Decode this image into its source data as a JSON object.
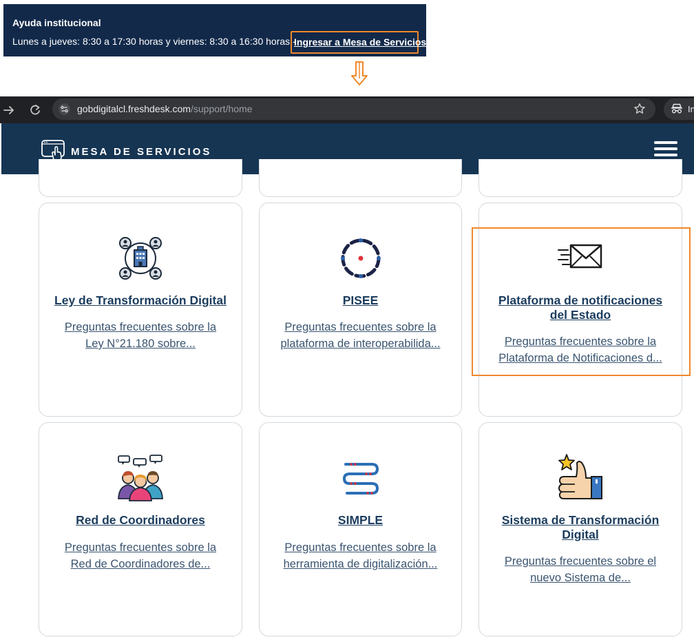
{
  "help_banner": {
    "title": "Ayuda institucional",
    "hours": "Lunes a jueves: 8:30 a 17:30 horas y viernes: 8:30 a 16:30 horas -",
    "link_label": "Ingresar a Mesa de Servicios"
  },
  "browser": {
    "url_host": "gobdigitalcl.freshdesk.com",
    "url_path": "/support/home",
    "incognito_label": "In"
  },
  "site": {
    "logo_text": "MESA DE SERVICIOS"
  },
  "cards": [
    {
      "title": "Ley de Transformación Digital",
      "desc_line1": "Preguntas frecuentes sobre la",
      "desc_line2": "Ley N°21.180 sobre...",
      "icon": "network-building-icon"
    },
    {
      "title": "PISEE",
      "desc_line1": "Preguntas frecuentes sobre la",
      "desc_line2": "plataforma de interoperabilida...",
      "icon": "pisee-ring-icon"
    },
    {
      "title_line1": "Plataforma de notificaciones",
      "title_line2": "del Estado",
      "desc_line1": "Preguntas frecuentes sobre la",
      "desc_line2": "Plataforma de Notificaciones d...",
      "icon": "envelope-icon"
    },
    {
      "title": "Red de Coordinadores",
      "desc_line1": "Preguntas frecuentes sobre la",
      "desc_line2": "Red de Coordinadores de...",
      "icon": "people-chat-icon"
    },
    {
      "title": "SIMPLE",
      "desc_line1": "Preguntas frecuentes sobre la",
      "desc_line2": "herramienta de digitalización...",
      "icon": "simple-flow-icon"
    },
    {
      "title_line1": "Sistema de Transformación",
      "title_line2": "Digital",
      "desc_line1": "Preguntas frecuentes sobre el",
      "desc_line2": "nuevo Sistema de...",
      "icon": "thumbs-up-star-icon"
    }
  ],
  "colors": {
    "banner_bg": "#12294a",
    "header_bg": "#163553",
    "highlight": "#f0882b",
    "card_title": "#1c3d5e"
  }
}
